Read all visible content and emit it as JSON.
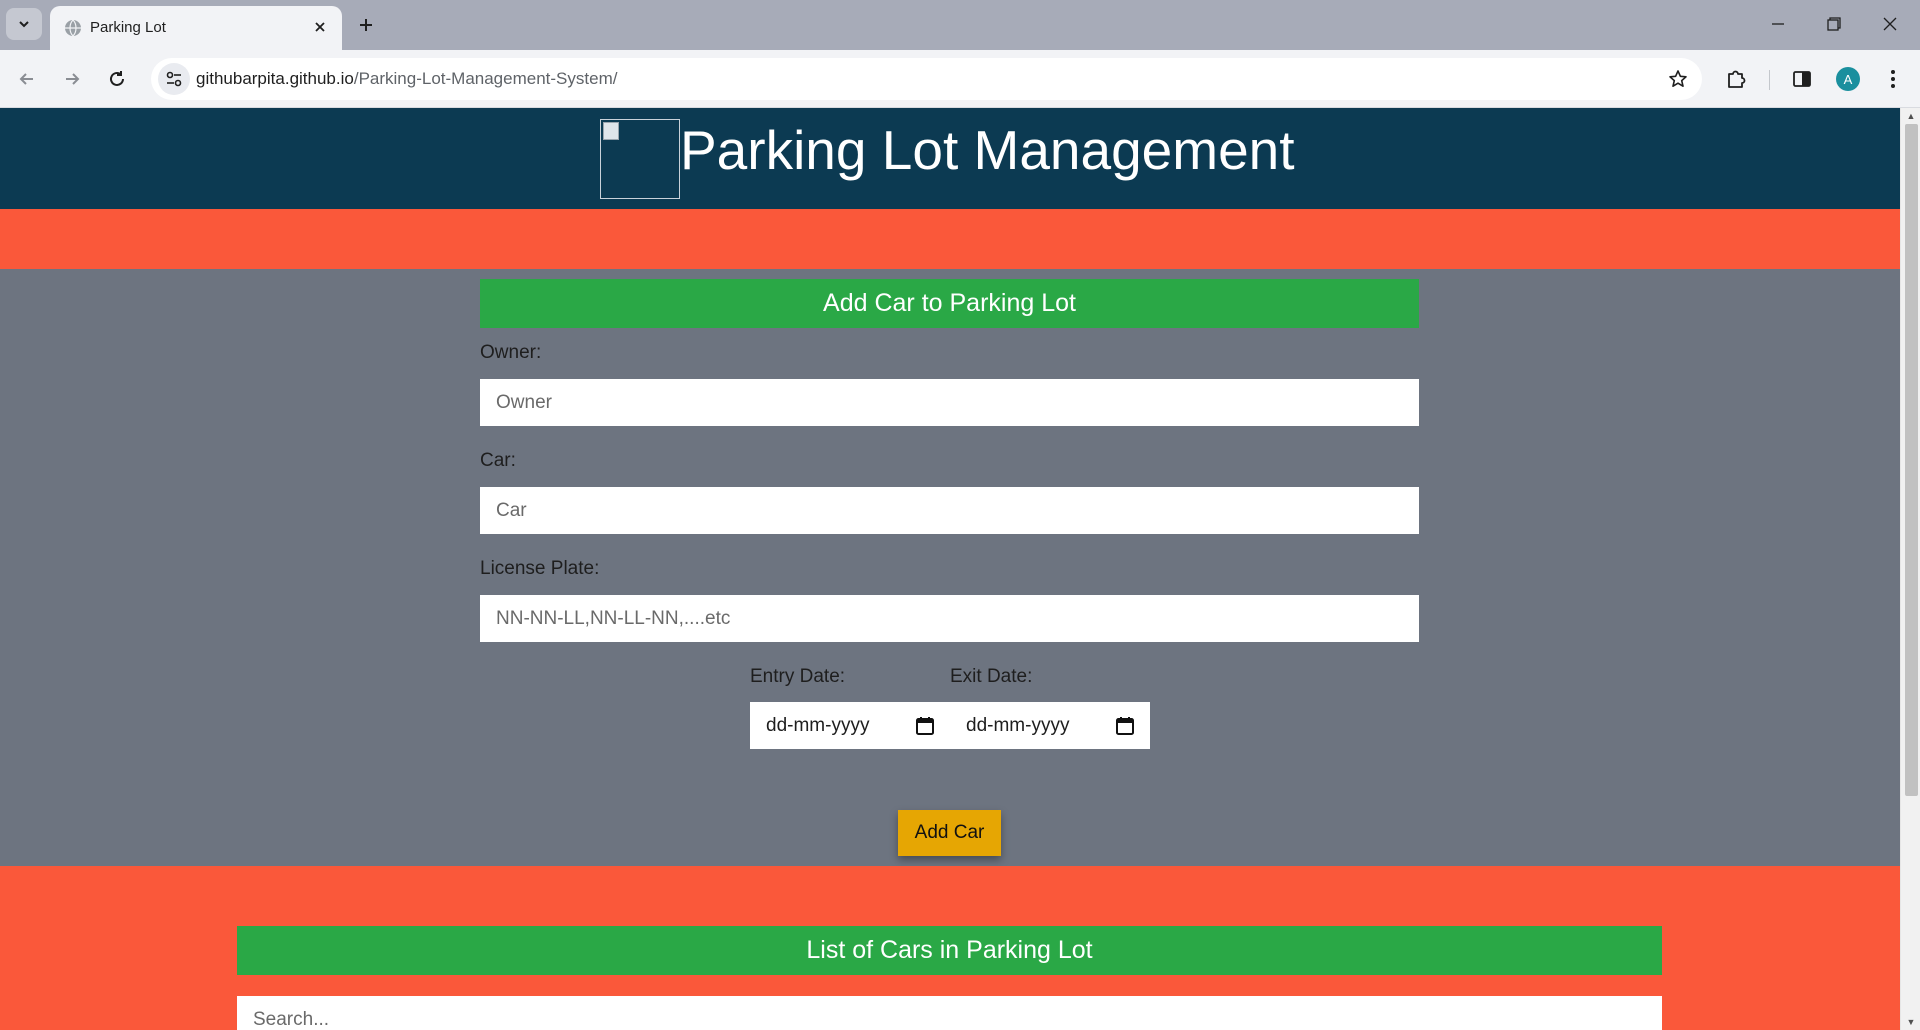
{
  "browser": {
    "tab_title": "Parking Lot",
    "url_host": "githubarpita.github.io",
    "url_path": "/Parking-Lot-Management-System/",
    "avatar_letter": "A"
  },
  "header": {
    "title": "Parking Lot Management"
  },
  "add_form": {
    "heading": "Add Car to Parking Lot",
    "owner_label": "Owner:",
    "owner_placeholder": "Owner",
    "car_label": "Car:",
    "car_placeholder": "Car",
    "plate_label": "License Plate:",
    "plate_placeholder": "NN-NN-LL,NN-LL-NN,....etc",
    "entry_label": "Entry Date:",
    "entry_value": "dd-mm-yyyy",
    "exit_label": "Exit Date:",
    "exit_value": "dd-mm-yyyy",
    "submit_label": "Add Car"
  },
  "list": {
    "heading": "List of Cars in Parking Lot",
    "search_placeholder": "Search..."
  },
  "colors": {
    "header_bg": "#0c3a52",
    "band_orange": "#fa583a",
    "section_green": "#2aa846",
    "form_bg": "#6d7480",
    "button_yellow": "#e6a603"
  }
}
